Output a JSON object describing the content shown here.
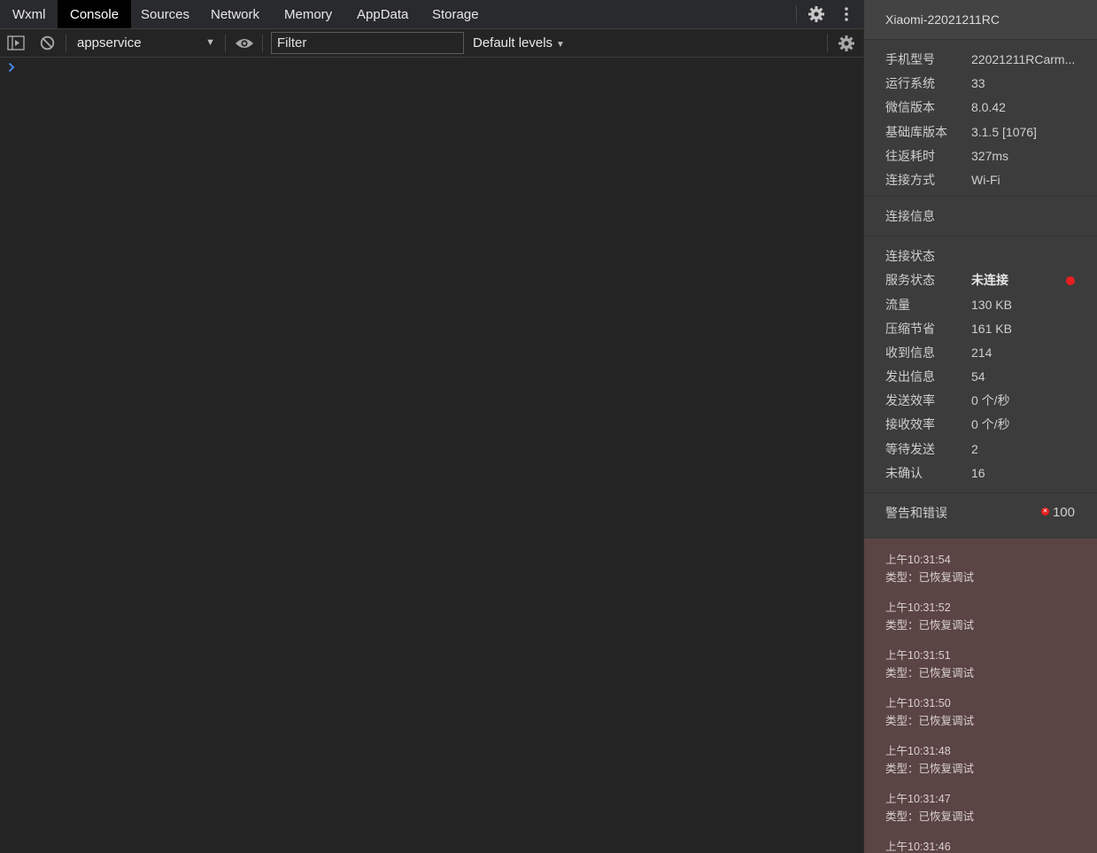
{
  "tabs": [
    "Wxml",
    "Console",
    "Sources",
    "Network",
    "Memory",
    "AppData",
    "Storage"
  ],
  "active_tab": "Console",
  "toolbar": {
    "context": "appservice",
    "filter_placeholder": "Filter",
    "levels": "Default levels"
  },
  "panel": {
    "device": "Xiaomi-22021211RC",
    "info": [
      {
        "key": "手机型号",
        "value": "22021211RCarm..."
      },
      {
        "key": "运行系统",
        "value": "33"
      },
      {
        "key": "微信版本",
        "value": "8.0.42"
      },
      {
        "key": "基础库版本",
        "value": "3.1.5 [1076]"
      },
      {
        "key": "往返耗时",
        "value": "327ms"
      },
      {
        "key": "连接方式",
        "value": "Wi-Fi"
      }
    ],
    "connection_info_title": "连接信息",
    "connection_status_title": "连接状态",
    "status": [
      {
        "key": "服务状态",
        "value": "未连接"
      },
      {
        "key": "流量",
        "value": "130 KB"
      },
      {
        "key": "压缩节省",
        "value": "161 KB"
      },
      {
        "key": "收到信息",
        "value": "214"
      },
      {
        "key": "发出信息",
        "value": "54"
      },
      {
        "key": "发送效率",
        "value": "0 个/秒"
      },
      {
        "key": "接收效率",
        "value": "0 个/秒"
      },
      {
        "key": "等待发送",
        "value": "2"
      },
      {
        "key": "未确认",
        "value": "16"
      }
    ],
    "warnings_title": "警告和错误",
    "warnings_count": "100",
    "logs": [
      {
        "time": "上午10:31:54",
        "desc": "类型：已恢复调试"
      },
      {
        "time": "上午10:31:52",
        "desc": "类型：已恢复调试"
      },
      {
        "time": "上午10:31:51",
        "desc": "类型：已恢复调试"
      },
      {
        "time": "上午10:31:50",
        "desc": "类型：已恢复调试"
      },
      {
        "time": "上午10:31:48",
        "desc": "类型：已恢复调试"
      },
      {
        "time": "上午10:31:47",
        "desc": "类型：已恢复调试"
      },
      {
        "time": "上午10:31:46",
        "desc": ""
      }
    ]
  },
  "colors": {
    "service_status_dot": "#e81e1e",
    "log_background": "#5b4444"
  }
}
